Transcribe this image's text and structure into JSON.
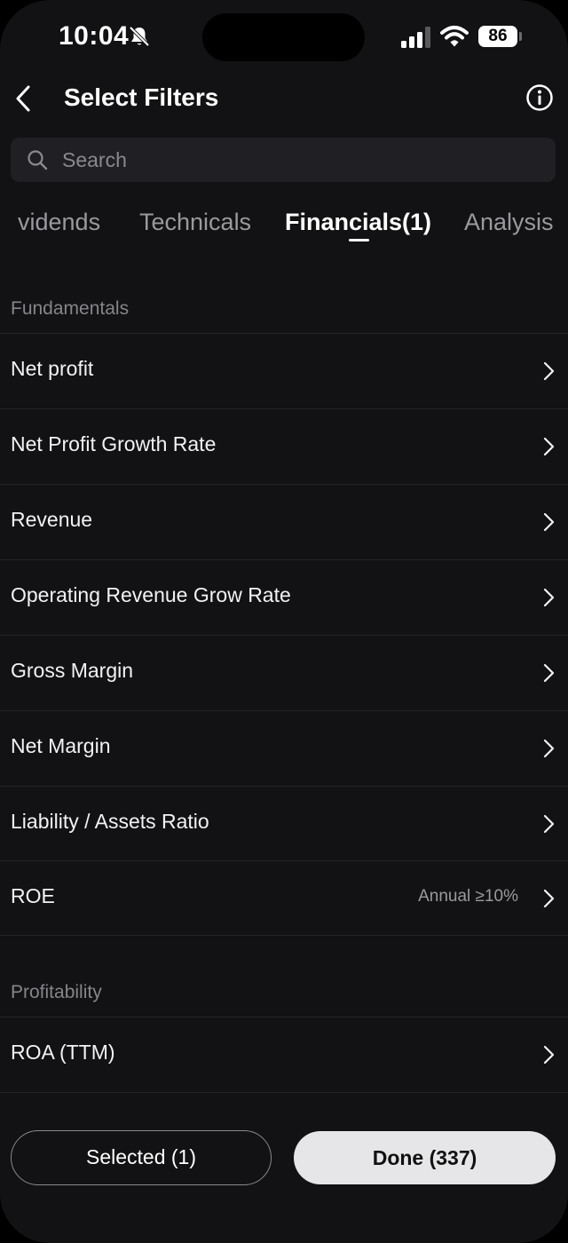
{
  "status_bar": {
    "time": "10:04",
    "battery": "86",
    "icons": [
      "bell-slash-icon",
      "signal-icon",
      "wifi-icon",
      "battery-icon"
    ]
  },
  "header": {
    "title": "Select Filters",
    "back_icon": "chevron-left-icon",
    "info_icon": "info-circle-icon"
  },
  "search": {
    "placeholder": "Search",
    "value": ""
  },
  "tabs": [
    {
      "label": "vidends",
      "active": false
    },
    {
      "label": "Technicals",
      "active": false
    },
    {
      "label": "Financials(1)",
      "active": true
    },
    {
      "label": "Analysis",
      "active": false
    }
  ],
  "sections": [
    {
      "title": "Fundamentals",
      "items": [
        {
          "label": "Net profit",
          "value": ""
        },
        {
          "label": "Net Profit Growth Rate",
          "value": ""
        },
        {
          "label": "Revenue",
          "value": ""
        },
        {
          "label": "Operating Revenue Grow Rate",
          "value": ""
        },
        {
          "label": "Gross Margin",
          "value": ""
        },
        {
          "label": "Net Margin",
          "value": ""
        },
        {
          "label": "Liability / Assets Ratio",
          "value": ""
        },
        {
          "label": "ROE",
          "value": "Annual ≥10%"
        }
      ]
    },
    {
      "title": "Profitability",
      "items": [
        {
          "label": "ROA (TTM)",
          "value": ""
        }
      ]
    }
  ],
  "footer": {
    "selected_label": "Selected (1)",
    "done_label": "Done (337)"
  },
  "colors": {
    "background": "#121214",
    "text": "#ffffff",
    "muted": "#86868a",
    "done_button": "#e6e6e8"
  }
}
